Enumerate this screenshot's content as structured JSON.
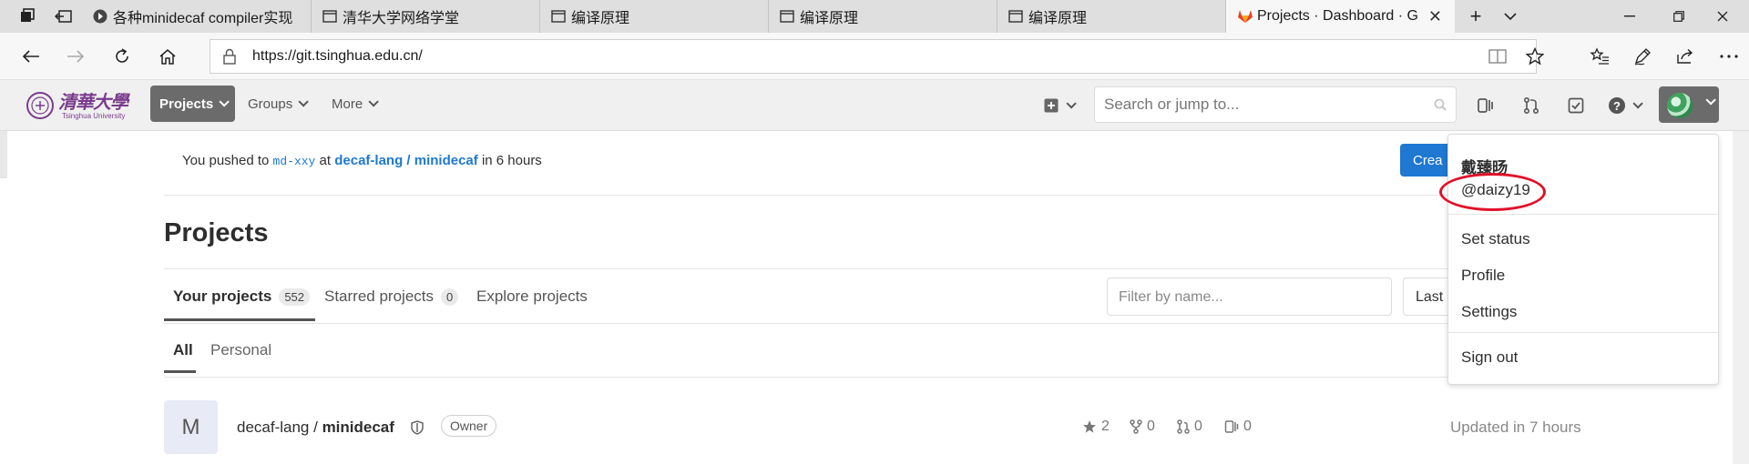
{
  "browser": {
    "tabs": [
      {
        "title": "各种minidecaf compiler实现",
        "icon": "page-dark-icon"
      },
      {
        "title": "清华大学网络学堂",
        "icon": "page-icon"
      },
      {
        "title": "编译原理",
        "icon": "page-icon"
      },
      {
        "title": "编译原理",
        "icon": "page-icon"
      },
      {
        "title": "编译原理",
        "icon": "page-icon"
      },
      {
        "title": "Projects · Dashboard · G",
        "icon": "gitlab-icon"
      }
    ],
    "url": "https://git.tsinghua.edu.cn/"
  },
  "navbar": {
    "logo_text": "清華大學",
    "logo_subtext": "Tsinghua University",
    "projects_label": "Projects",
    "groups_label": "Groups",
    "more_label": "More",
    "search_placeholder": "Search or jump to..."
  },
  "notice": {
    "prefix": "You pushed to",
    "branch": "md-xxy",
    "mid": "at",
    "project": "decaf-lang / minidecaf",
    "suffix": "in 6 hours"
  },
  "create_button_label": "Crea",
  "page_title": "Projects",
  "project_tabs": [
    {
      "label": "Your projects",
      "count": "552"
    },
    {
      "label": "Starred projects",
      "count": "0"
    },
    {
      "label": "Explore projects"
    }
  ],
  "filter_placeholder": "Filter by name...",
  "sort_label": "Last",
  "subtabs": [
    "All",
    "Personal"
  ],
  "project": {
    "avatar_letter": "M",
    "namespace": "decaf-lang / ",
    "name": "minidecaf",
    "role": "Owner",
    "stars": "2",
    "forks": "0",
    "merge_requests": "0",
    "issues": "0",
    "updated": "Updated in 7 hours"
  },
  "user_menu": {
    "name": "戴臻旸",
    "handle": "@daizy19",
    "items": [
      "Set status",
      "Profile",
      "Settings"
    ],
    "sign_out": "Sign out"
  },
  "colors": {
    "accent": "#1f78d1",
    "highlight_ellipse": "#e0112a",
    "nav_selected": "#6b6b6b"
  }
}
